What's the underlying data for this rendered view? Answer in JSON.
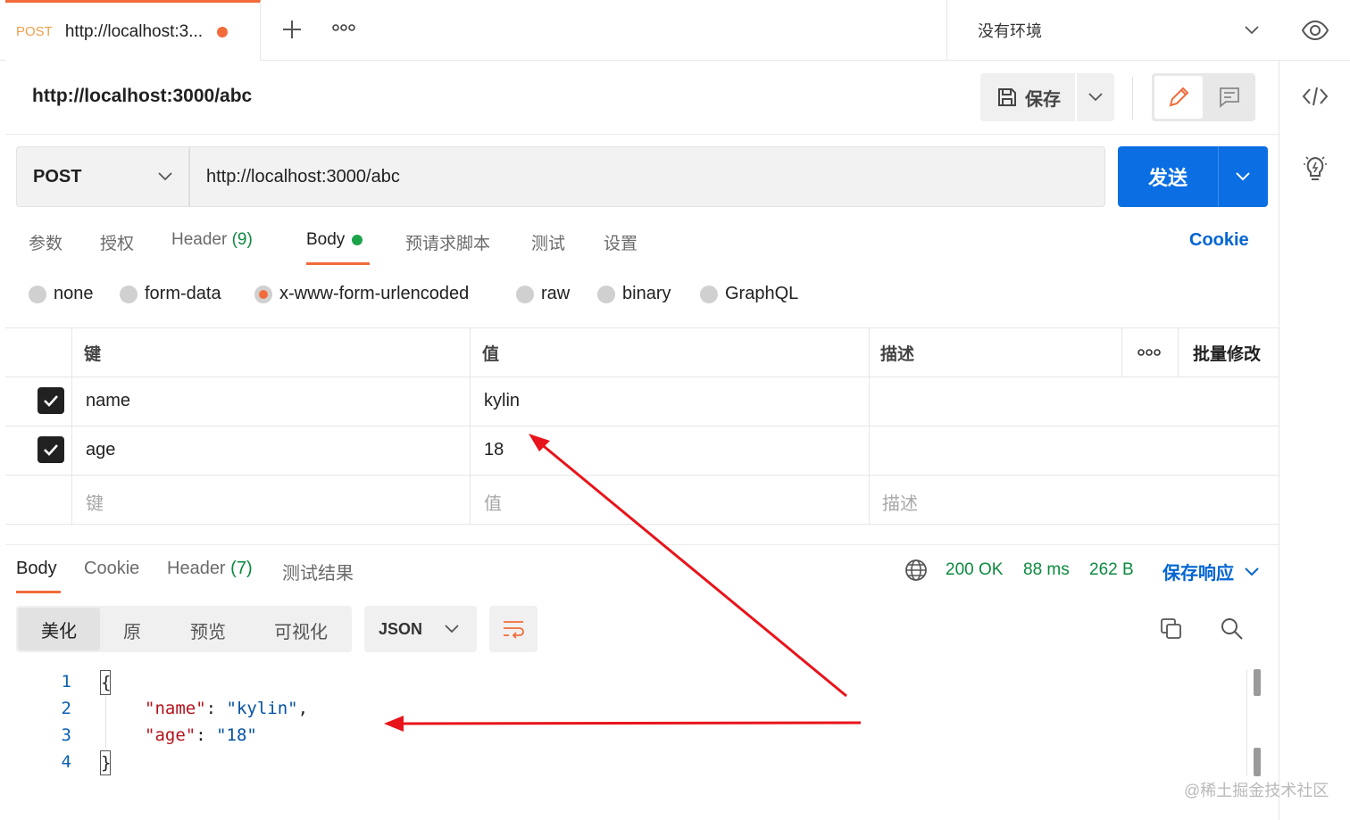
{
  "tab": {
    "method": "POST",
    "title": "http://localhost:3...",
    "new_tab_icon": "plus-icon",
    "more_icon": "ellipsis-icon"
  },
  "env": {
    "label": "没有环境"
  },
  "request": {
    "name": "http://localhost:3000/abc",
    "save_label": "保存",
    "method": "POST",
    "url": "http://localhost:3000/abc",
    "send_label": "发送"
  },
  "req_tabs": {
    "params": "参数",
    "auth": "授权",
    "header_label": "Header",
    "header_count": "(9)",
    "body": "Body",
    "prescript": "预请求脚本",
    "tests": "测试",
    "settings": "设置",
    "cookie": "Cookie"
  },
  "body_types": {
    "none": "none",
    "form_data": "form-data",
    "urlencoded": "x-www-form-urlencoded",
    "raw": "raw",
    "binary": "binary",
    "graphql": "GraphQL",
    "selected": "x-www-form-urlencoded"
  },
  "table": {
    "headers": {
      "key": "键",
      "value": "值",
      "desc": "描述",
      "bulk": "批量修改"
    },
    "rows": [
      {
        "key": "name",
        "value": "kylin",
        "checked": true
      },
      {
        "key": "age",
        "value": "18",
        "checked": true
      }
    ],
    "placeholder": {
      "key": "键",
      "value": "值",
      "desc": "描述"
    }
  },
  "response": {
    "tabs": {
      "body": "Body",
      "cookie": "Cookie",
      "header_label": "Header",
      "header_count": "(7)",
      "tests": "测试结果"
    },
    "status": "200 OK",
    "time": "88 ms",
    "size": "262 B",
    "save_label": "保存响应",
    "views": {
      "pretty": "美化",
      "raw": "原",
      "preview": "预览",
      "visualize": "可视化"
    },
    "format": "JSON",
    "code_lines": {
      "n1": "1",
      "n2": "2",
      "n3": "3",
      "n4": "4",
      "open": "{",
      "k1": "\"name\"",
      "v1": "\"kylin\"",
      "k2": "\"age\"",
      "v2": "\"18\"",
      "close": "}"
    }
  },
  "watermark": "@稀土掘金技术社区",
  "colors": {
    "accent": "#f26b3a",
    "send": "#0b6ee3",
    "link": "#0265d2",
    "status": "#0b8a3e",
    "annotation": "#e8141b"
  }
}
